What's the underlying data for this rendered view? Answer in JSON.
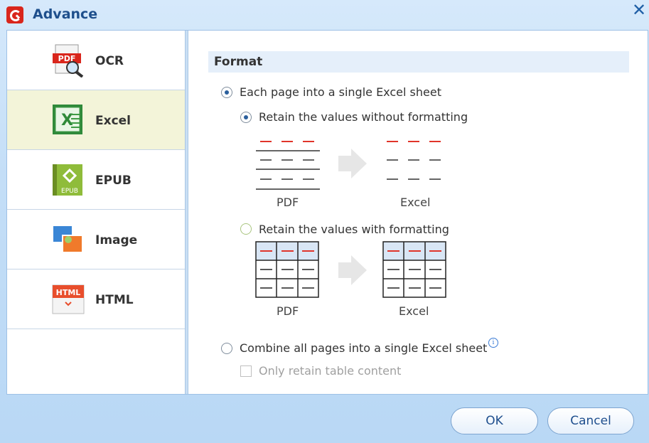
{
  "window": {
    "title": "Advance"
  },
  "sidebar": {
    "items": [
      {
        "label": "OCR",
        "icon": "ocr-pdf-icon",
        "active": false
      },
      {
        "label": "Excel",
        "icon": "excel-icon",
        "active": true
      },
      {
        "label": "EPUB",
        "icon": "epub-icon",
        "active": false
      },
      {
        "label": "Image",
        "icon": "image-icon",
        "active": false
      },
      {
        "label": "HTML",
        "icon": "html-icon",
        "active": false
      }
    ],
    "ocr_icon_text": "PDF",
    "epub_icon_text": "EPUB",
    "html_icon_text": "HTML"
  },
  "format": {
    "header": "Format",
    "option_each_page": "Each page into a single Excel sheet",
    "option_without_formatting": "Retain the values without formatting",
    "option_with_formatting": "Retain the values with formatting",
    "option_combine": "Combine all pages into a single Excel sheet",
    "option_only_table": "Only retain table content",
    "info_glyph": "i",
    "captions": {
      "pdf": "PDF",
      "excel": "Excel"
    }
  },
  "buttons": {
    "ok": "OK",
    "cancel": "Cancel"
  },
  "colors": {
    "accent": "#1e4f8c",
    "active_item_bg": "#f3f4d9",
    "red_line": "#e0342a"
  }
}
